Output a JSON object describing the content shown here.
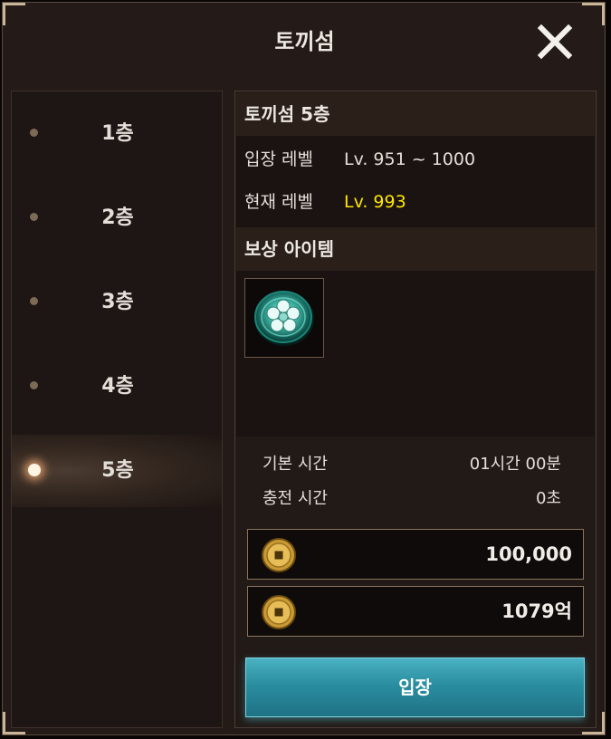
{
  "window": {
    "title": "토끼섬"
  },
  "floors": [
    {
      "label": "1층"
    },
    {
      "label": "2층"
    },
    {
      "label": "3층"
    },
    {
      "label": "4층"
    },
    {
      "label": "5층",
      "selected": true
    }
  ],
  "detail": {
    "title": "토끼섬 5층",
    "entry_level_label": "입장 레벨",
    "entry_level_value": "Lv. 951 ~ 1000",
    "current_level_label": "현재 레벨",
    "current_level_value": "Lv. 993",
    "reward_header": "보상 아이템",
    "reward_items": [
      {
        "icon": "jade-flower-medallion-icon"
      }
    ],
    "base_time_label": "기본 시간",
    "base_time_value": "01시간 00분",
    "charge_time_label": "충전 시간",
    "charge_time_value": "0초",
    "costs": [
      {
        "icon": "gold-coin-icon",
        "amount": "100,000"
      },
      {
        "icon": "gold-coin-icon",
        "amount": "1079억"
      }
    ],
    "enter_label": "입장"
  },
  "colors": {
    "current_level": "#ffe600",
    "button": "#2a8ea0"
  }
}
